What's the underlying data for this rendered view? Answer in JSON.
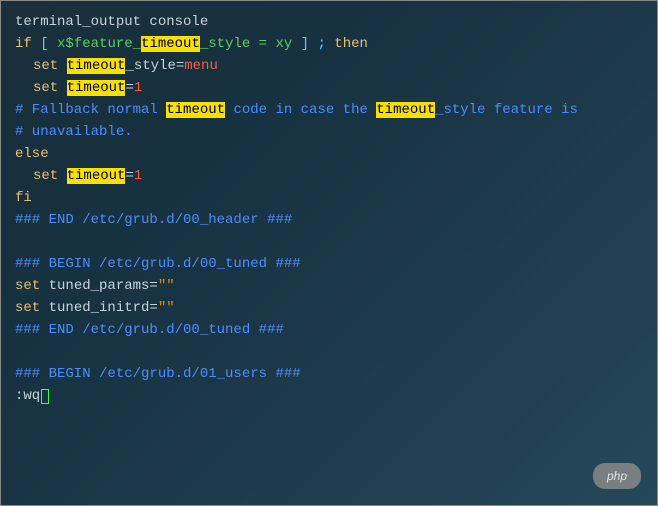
{
  "line1": {
    "a": "terminal_output console"
  },
  "line2": {
    "kw1": "if",
    "br1": " [ ",
    "var1": "x$feature_",
    "hl": "timeout",
    "var2": "_style = xy",
    "br2": " ] ; ",
    "kw2": "then"
  },
  "line3": {
    "kw": "set",
    "sp": " ",
    "hl": "timeout",
    "rest": "_style=",
    "val": "menu"
  },
  "line4": {
    "kw": "set",
    "sp": " ",
    "hl": "timeout",
    "rest": "=",
    "val": "1"
  },
  "line5": {
    "a": "# Fallback normal ",
    "hl1": "timeout",
    "b": " code in case the ",
    "hl2": "timeout",
    "c": "_style feature is"
  },
  "line6": {
    "a": "# unavailable."
  },
  "line7": {
    "a": "else"
  },
  "line8": {
    "kw": "set",
    "sp": " ",
    "hl": "timeout",
    "rest": "=",
    "val": "1"
  },
  "line9": {
    "a": "fi"
  },
  "line10": {
    "a": "### END /etc/grub.d/00_header ###"
  },
  "blank": " ",
  "line12": {
    "a": "### BEGIN /etc/grub.d/00_tuned ###"
  },
  "line13": {
    "a": "set",
    "b": " tuned_params=",
    "q": "\"\""
  },
  "line14": {
    "a": "set",
    "b": " tuned_initrd=",
    "q": "\"\""
  },
  "line15": {
    "a": "### END /etc/grub.d/00_tuned ###"
  },
  "line17": {
    "a": "### BEGIN /etc/grub.d/01_users ###"
  },
  "vim": {
    "cmd": ":wq"
  },
  "watermark": "php"
}
